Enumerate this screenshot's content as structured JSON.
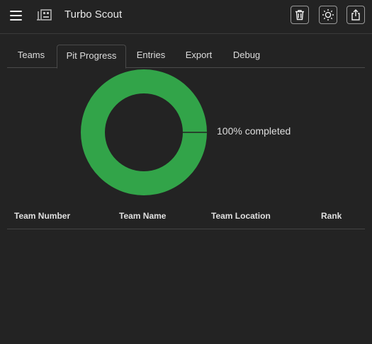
{
  "app": {
    "title": "Turbo Scout"
  },
  "toolbar": {
    "menu_icon": "hamburger-menu-icon",
    "logo_icon": "robot-logo-icon",
    "delete_icon": "trash-icon",
    "theme_icon": "sun-icon",
    "share_icon": "share-icon"
  },
  "tabs": [
    {
      "label": "Teams",
      "active": false
    },
    {
      "label": "Pit Progress",
      "active": true
    },
    {
      "label": "Entries",
      "active": false
    },
    {
      "label": "Export",
      "active": false
    },
    {
      "label": "Debug",
      "active": false
    }
  ],
  "chart_data": {
    "type": "pie",
    "values": [
      100
    ],
    "colors": [
      "#32a449"
    ],
    "label": "100% completed"
  },
  "table": {
    "headers": [
      "Team Number",
      "Team Name",
      "Team Location",
      "Rank"
    ],
    "rows": []
  },
  "colors": {
    "background": "#232323",
    "accent_green": "#32a449"
  }
}
